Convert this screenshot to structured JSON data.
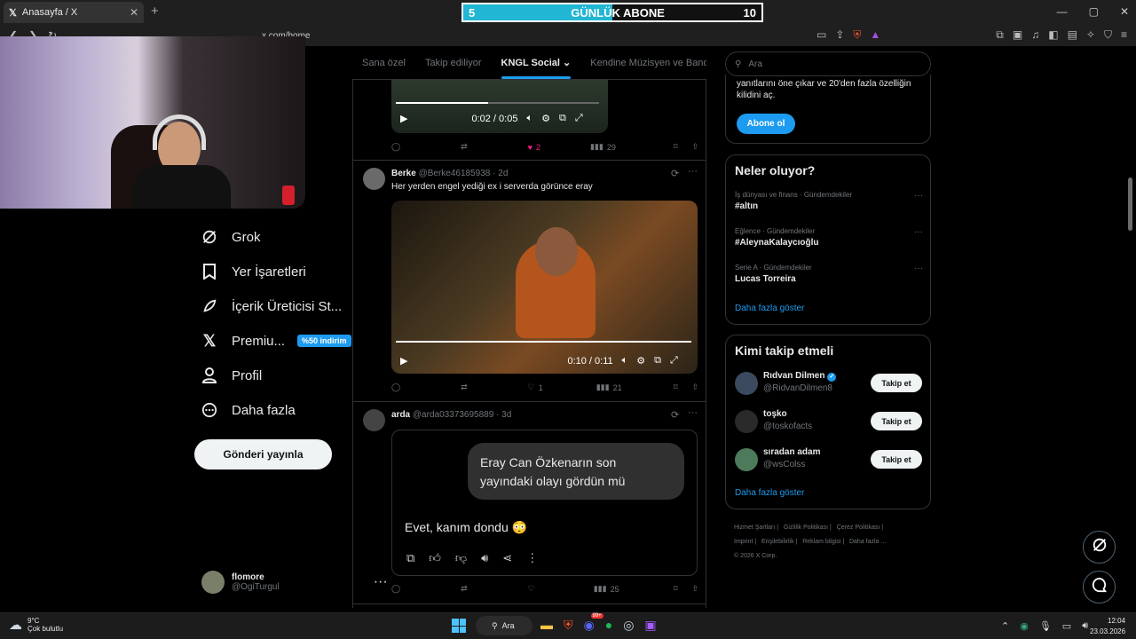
{
  "browser": {
    "tab_title": "Anasayfa / X",
    "url": "x.com/home",
    "sub_goal": {
      "left": "5",
      "label": "GÜNLÜK ABONE",
      "right": "10",
      "progress": 0.5
    }
  },
  "nav": {
    "grok": "Grok",
    "bookmarks": "Yer İşaretleri",
    "creator_studio": "İçerik Üreticisi St...",
    "premium": "Premiu...",
    "premium_badge": "%50 indirim",
    "profile": "Profil",
    "more": "Daha fazla",
    "post_button": "Gönderi yayınla"
  },
  "account": {
    "name": "flomore",
    "handle": "@OgiTurgul"
  },
  "feed_tabs": [
    "Sana özel",
    "Takip ediliyor",
    "KNGL Social",
    "Kendine Müzisyen ve Bandosu"
  ],
  "posts": [
    {
      "video_time": "0:02 / 0:05",
      "likes": "2",
      "views": "29"
    },
    {
      "name": "Berke",
      "handle": "@Berke46185938",
      "age": "· 2d",
      "text": "Her yerden engel yediği ex i serverda görünce eray",
      "video_time": "0:10 / 0:11",
      "likes": "1",
      "views": "21"
    },
    {
      "name": "arda",
      "handle": "@arda03373695889",
      "age": "· 3d",
      "bubble": "Eray Can Özkenarın son yayındaki olayı gördün mü",
      "reply": "Evet, kanım dondu 😳",
      "views": "25"
    }
  ],
  "search": {
    "placeholder": "Ara"
  },
  "premium_card": {
    "text": "yanıtlarını öne çıkar ve 20'den fazla özelliğin kilidini aç.",
    "button": "Abone ol"
  },
  "trends": {
    "title": "Neler oluyor?",
    "items": [
      {
        "context": "İş dünyası ve finans · Gündemdekiler",
        "name": "#altın"
      },
      {
        "context": "Eğlence · Gündemdekiler",
        "name": "#AleynaKalaycıoğlu"
      },
      {
        "context": "Serie A · Gündemdekiler",
        "name": "Lucas Torreira"
      }
    ],
    "more": "Daha fazla göster"
  },
  "who_to_follow": {
    "title": "Kimi takip etmeli",
    "users": [
      {
        "name": "Rıdvan Dilmen",
        "handle": "@RidvanDilmen8",
        "button": "Takip et"
      },
      {
        "name": "toşko",
        "handle": "@toskofacts",
        "button": "Takip et"
      },
      {
        "name": "sıradan adam",
        "handle": "@wsColss",
        "button": "Takip et"
      }
    ],
    "more": "Daha fazla göster"
  },
  "footer": {
    "links": [
      "Hizmet Şartları",
      "Gizlilik Politikası",
      "Çerez Politikası",
      "Imprint",
      "Erişilebilirlik",
      "Reklam bilgisi",
      "Daha fazla ..."
    ],
    "copyright": "© 2026 X Corp."
  },
  "taskbar": {
    "weather_temp": "9°C",
    "weather_desc": "Çok bulutlu",
    "search": "Ara",
    "time": "12:04",
    "date": "23.03.2026",
    "badge": "99+"
  }
}
